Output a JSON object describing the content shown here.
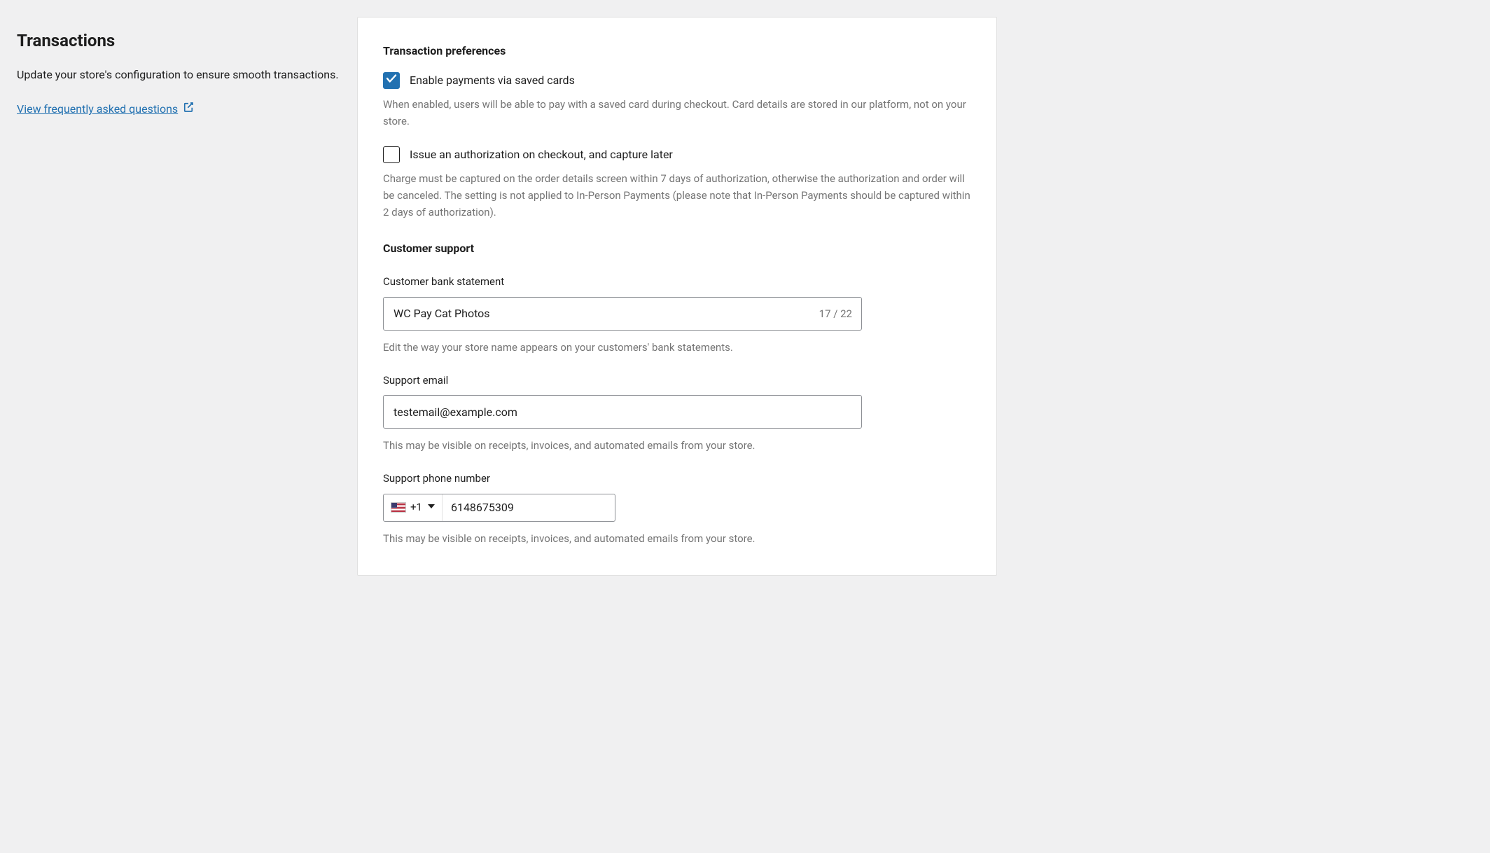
{
  "sidebar": {
    "title": "Transactions",
    "description": "Update your store's configuration to ensure smooth transactions.",
    "faq_link": "View frequently asked questions"
  },
  "panel": {
    "preferences_heading": "Transaction preferences",
    "saved_cards": {
      "label": "Enable payments via saved cards",
      "checked": true,
      "help": "When enabled, users will be able to pay with a saved card during checkout. Card details are stored in our platform, not on your store."
    },
    "auth_capture": {
      "label": "Issue an authorization on checkout, and capture later",
      "checked": false,
      "help": "Charge must be captured on the order details screen within 7 days of authorization, otherwise the authorization and order will be canceled. The setting is not applied to In-Person Payments (please note that In-Person Payments should be captured within 2 days of authorization)."
    },
    "support_heading": "Customer support",
    "bank_statement": {
      "label": "Customer bank statement",
      "value": "WC Pay Cat Photos",
      "counter": "17 / 22",
      "help": "Edit the way your store name appears on your customers' bank statements."
    },
    "support_email": {
      "label": "Support email",
      "value": "testemail@example.com",
      "help": "This may be visible on receipts, invoices, and automated emails from your store."
    },
    "support_phone": {
      "label": "Support phone number",
      "dial_code": "+1",
      "number": "6148675309",
      "help": "This may be visible on receipts, invoices, and automated emails from your store."
    }
  }
}
